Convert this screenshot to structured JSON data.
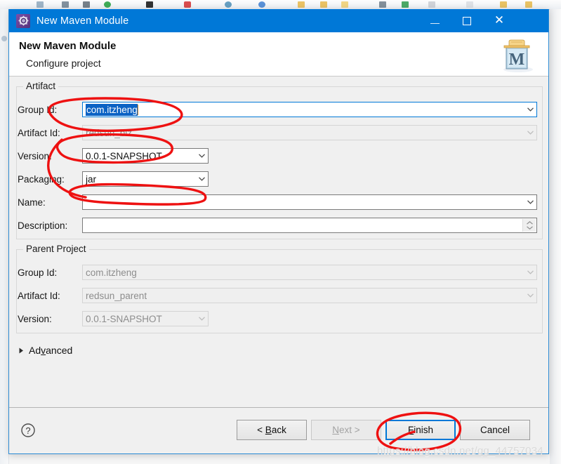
{
  "window": {
    "title": "New Maven Module",
    "icon": "maven-gear-icon",
    "accent_color": "#0078d7",
    "controls": {
      "minimize": "minimize-icon",
      "maximize": "maximize-icon",
      "close": "close-icon"
    }
  },
  "header": {
    "title": "New Maven Module",
    "subtitle": "Configure project",
    "banner_icon": "maven-box-icon"
  },
  "artifact": {
    "legend": "Artifact",
    "fields": [
      {
        "label": "Group Id:",
        "value": "com.itzheng",
        "state": "focused-selected",
        "control": "combo"
      },
      {
        "label": "Artifact Id:",
        "value": "redsun_biz",
        "state": "disabled",
        "control": "combo"
      },
      {
        "label": "Version:",
        "value": "0.0.1-SNAPSHOT",
        "state": "enabled",
        "control": "combo"
      },
      {
        "label": "Packaging:",
        "value": "jar",
        "state": "enabled",
        "control": "combo"
      },
      {
        "label": "Name:",
        "value": "",
        "state": "enabled",
        "control": "combo"
      },
      {
        "label": "Description:",
        "value": "",
        "state": "enabled",
        "control": "spinner"
      }
    ]
  },
  "parent_project": {
    "legend": "Parent Project",
    "fields": [
      {
        "label": "Group Id:",
        "value": "com.itzheng",
        "state": "disabled",
        "control": "combo"
      },
      {
        "label": "Artifact Id:",
        "value": "redsun_parent",
        "state": "disabled",
        "control": "combo"
      },
      {
        "label": "Version:",
        "value": "0.0.1-SNAPSHOT",
        "state": "disabled",
        "control": "combo"
      }
    ]
  },
  "advanced": {
    "label": "Advanced",
    "mnemonic": "v",
    "expanded": false,
    "arrow_icon": "triangle-right-icon"
  },
  "footer": {
    "help_icon": "help-question-icon",
    "buttons": [
      {
        "name": "back",
        "text_before": "< ",
        "mnemonic": "B",
        "text_after": "ack",
        "state": "enabled"
      },
      {
        "name": "next",
        "text_before": "",
        "mnemonic": "N",
        "text_after": "ext >",
        "state": "disabled"
      },
      {
        "name": "finish",
        "text_before": "",
        "mnemonic": "F",
        "text_after": "inish",
        "state": "default"
      },
      {
        "name": "cancel",
        "text_before": "",
        "mnemonic": "",
        "text_after": "Cancel",
        "state": "enabled"
      }
    ]
  },
  "annotations": {
    "color": "#ee1111",
    "marks": [
      "ellipse-around-group-id",
      "ellipse-around-artifact-id",
      "ellipse-around-packaging",
      "ellipse-around-finish-button"
    ]
  },
  "watermark": {
    "text": "https://blog.csdn.net/qq_44757034"
  }
}
